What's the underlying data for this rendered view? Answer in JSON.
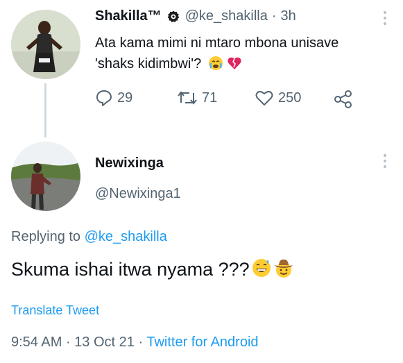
{
  "original_tweet": {
    "display_name": "Shakilla™",
    "handle": "@ke_shakilla",
    "separator": "·",
    "time": "3h",
    "text_line1": "Ata kama mimi ni mtaro mbona unisave",
    "text_line2": "'shaks kidimbwi'?",
    "emojis": [
      "crying-face",
      "broken-heart"
    ],
    "replies": "29",
    "retweets": "71",
    "likes": "250"
  },
  "reply_tweet": {
    "display_name": "Newixinga",
    "handle": "@Newixinga1",
    "replying_to_label": "Replying to",
    "replying_to_handle": "@ke_shakilla",
    "text": "Skuma ishai itwa nyama ???",
    "emojis": [
      "grinning-sweat-face",
      "cowboy-face"
    ],
    "translate_label": "Translate Tweet",
    "time": "9:54 AM",
    "dot": "·",
    "date": "13 Oct 21",
    "source": "Twitter for Android"
  },
  "colors": {
    "link": "#1d9bf0",
    "muted": "#536471",
    "thread_line": "#cfd9de"
  }
}
